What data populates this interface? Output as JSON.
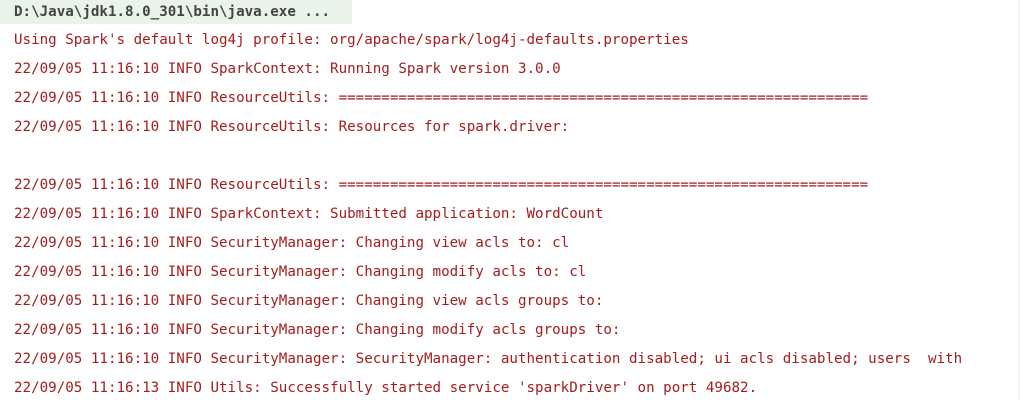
{
  "console": {
    "command": "D:\\Java\\jdk1.8.0_301\\bin\\java.exe ...",
    "lines": [
      "Using Spark's default log4j profile: org/apache/spark/log4j-defaults.properties",
      "22/09/05 11:16:10 INFO SparkContext: Running Spark version 3.0.0",
      "22/09/05 11:16:10 INFO ResourceUtils: ==============================================================",
      "22/09/05 11:16:10 INFO ResourceUtils: Resources for spark.driver:",
      "",
      "22/09/05 11:16:10 INFO ResourceUtils: ==============================================================",
      "22/09/05 11:16:10 INFO SparkContext: Submitted application: WordCount",
      "22/09/05 11:16:10 INFO SecurityManager: Changing view acls to: cl",
      "22/09/05 11:16:10 INFO SecurityManager: Changing modify acls to: cl",
      "22/09/05 11:16:10 INFO SecurityManager: Changing view acls groups to:",
      "22/09/05 11:16:10 INFO SecurityManager: Changing modify acls groups to:",
      "22/09/05 11:16:10 INFO SecurityManager: SecurityManager: authentication disabled; ui acls disabled; users  with",
      "22/09/05 11:16:13 INFO Utils: Successfully started service 'sparkDriver' on port 49682."
    ]
  }
}
